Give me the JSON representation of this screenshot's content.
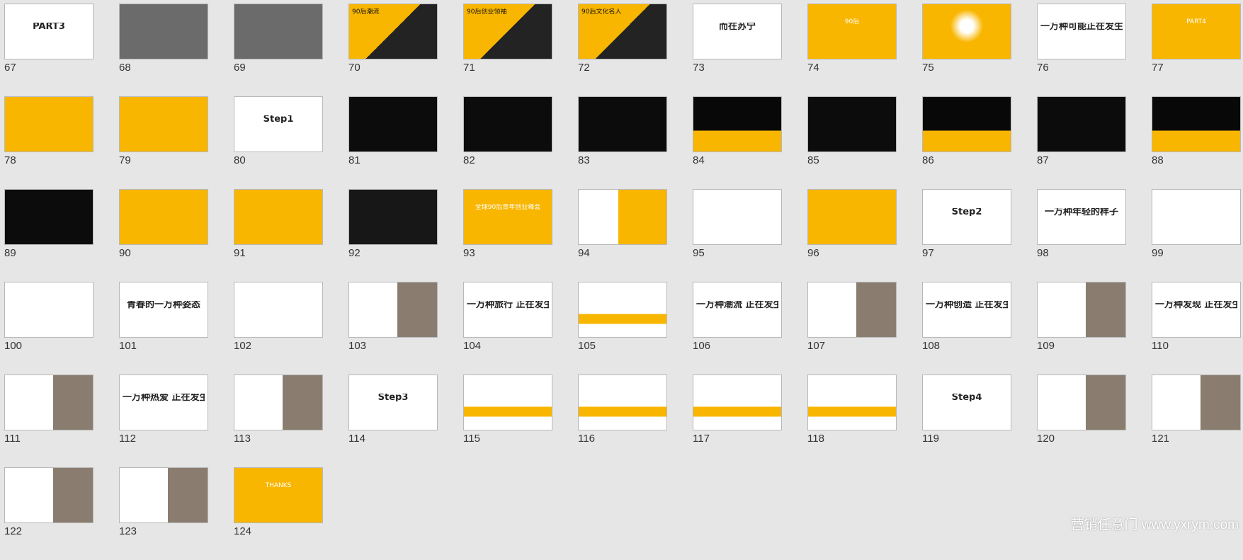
{
  "watermark": "营销任意门 www.yxrym.com",
  "slides": [
    {
      "number": "67",
      "style": "white",
      "title": "PART3"
    },
    {
      "number": "68",
      "style": "photo",
      "title": ""
    },
    {
      "number": "69",
      "style": "photo",
      "title": ""
    },
    {
      "number": "70",
      "style": "split",
      "title": "90后潮流"
    },
    {
      "number": "71",
      "style": "split",
      "title": "90后创业领袖"
    },
    {
      "number": "72",
      "style": "split",
      "title": "90后文化名人"
    },
    {
      "number": "73",
      "style": "white",
      "title": "而在苏宁"
    },
    {
      "number": "74",
      "style": "yellow",
      "title": "90后"
    },
    {
      "number": "75",
      "style": "halo",
      "title": ""
    },
    {
      "number": "76",
      "style": "white",
      "title": "一万种可能正在发生"
    },
    {
      "number": "77",
      "style": "yellow",
      "title": "PART4"
    },
    {
      "number": "78",
      "style": "yellow",
      "title": ""
    },
    {
      "number": "79",
      "style": "yellow",
      "title": ""
    },
    {
      "number": "80",
      "style": "white",
      "title": "Step1"
    },
    {
      "number": "81",
      "style": "black",
      "title": ""
    },
    {
      "number": "82",
      "style": "black",
      "title": ""
    },
    {
      "number": "83",
      "style": "black",
      "title": ""
    },
    {
      "number": "84",
      "style": "blackband",
      "title": ""
    },
    {
      "number": "85",
      "style": "black",
      "title": ""
    },
    {
      "number": "86",
      "style": "blackband",
      "title": ""
    },
    {
      "number": "87",
      "style": "black",
      "title": ""
    },
    {
      "number": "88",
      "style": "blackband",
      "title": ""
    },
    {
      "number": "89",
      "style": "black",
      "title": ""
    },
    {
      "number": "90",
      "style": "yellow",
      "title": ""
    },
    {
      "number": "91",
      "style": "yellow",
      "title": ""
    },
    {
      "number": "92",
      "style": "dark",
      "title": ""
    },
    {
      "number": "93",
      "style": "yellow",
      "title": "全球90后青年创业峰会"
    },
    {
      "number": "94",
      "style": "halfyellow",
      "title": ""
    },
    {
      "number": "95",
      "style": "white",
      "title": ""
    },
    {
      "number": "96",
      "style": "yellow",
      "title": ""
    },
    {
      "number": "97",
      "style": "white",
      "title": "Step2"
    },
    {
      "number": "98",
      "style": "white",
      "title": "一万种年轻的样子"
    },
    {
      "number": "99",
      "style": "white",
      "title": ""
    },
    {
      "number": "100",
      "style": "white",
      "title": ""
    },
    {
      "number": "101",
      "style": "white",
      "title": "青春的一万种姿态"
    },
    {
      "number": "102",
      "style": "white",
      "title": ""
    },
    {
      "number": "103",
      "style": "whitephoto",
      "title": ""
    },
    {
      "number": "104",
      "style": "white",
      "title": "一万种旅行 正在发生"
    },
    {
      "number": "105",
      "style": "whitebar",
      "title": ""
    },
    {
      "number": "106",
      "style": "white",
      "title": "一万种潮流 正在发生"
    },
    {
      "number": "107",
      "style": "whitephoto",
      "title": ""
    },
    {
      "number": "108",
      "style": "white",
      "title": "一万种创造 正在发生"
    },
    {
      "number": "109",
      "style": "whitephoto",
      "title": ""
    },
    {
      "number": "110",
      "style": "white",
      "title": "一万种发现 正在发生"
    },
    {
      "number": "111",
      "style": "whitephoto",
      "title": ""
    },
    {
      "number": "112",
      "style": "white",
      "title": "一万种热爱 正在发生"
    },
    {
      "number": "113",
      "style": "whitephoto",
      "title": ""
    },
    {
      "number": "114",
      "style": "white",
      "title": "Step3"
    },
    {
      "number": "115",
      "style": "whitebar",
      "title": ""
    },
    {
      "number": "116",
      "style": "whitebar",
      "title": ""
    },
    {
      "number": "117",
      "style": "whitebar",
      "title": ""
    },
    {
      "number": "118",
      "style": "whitebar",
      "title": ""
    },
    {
      "number": "119",
      "style": "white",
      "title": "Step4"
    },
    {
      "number": "120",
      "style": "whitephoto",
      "title": ""
    },
    {
      "number": "121",
      "style": "whitephoto",
      "title": ""
    },
    {
      "number": "122",
      "style": "whitephoto",
      "title": ""
    },
    {
      "number": "123",
      "style": "whitephoto",
      "title": ""
    },
    {
      "number": "124",
      "style": "yellow",
      "title": "THANKS"
    }
  ]
}
